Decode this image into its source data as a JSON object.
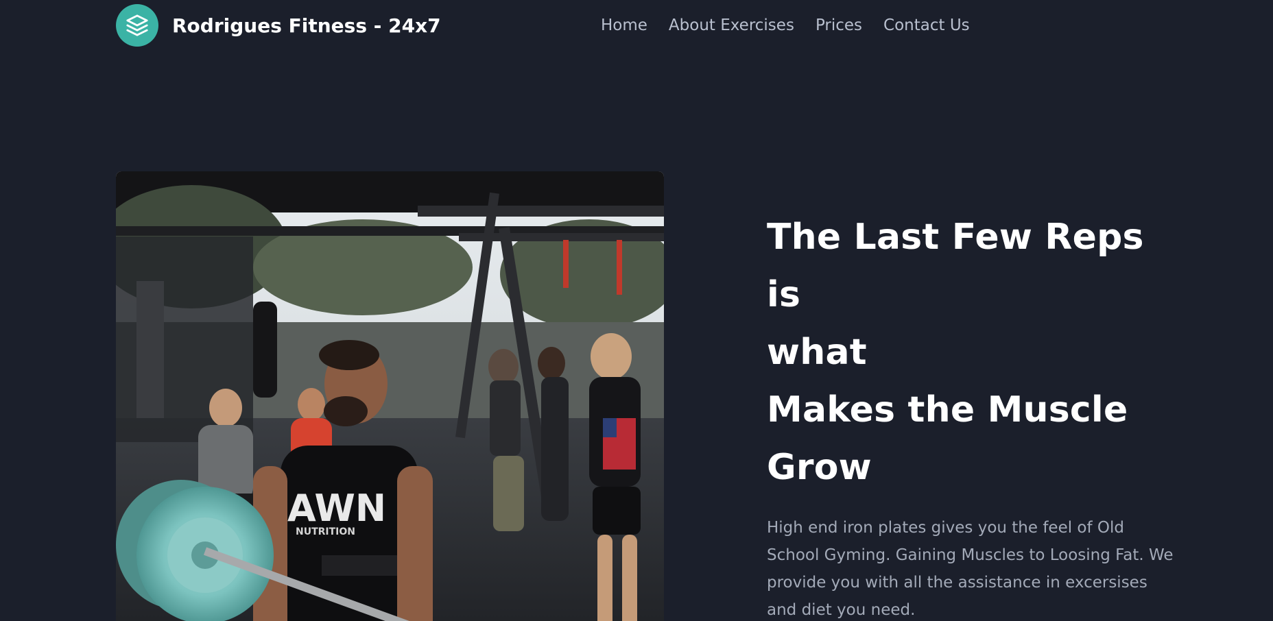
{
  "header": {
    "brand_name": "Rodrigues Fitness - 24x7",
    "logo_icon": "layers-icon",
    "nav": [
      {
        "label": "Home"
      },
      {
        "label": "About Exercises"
      },
      {
        "label": "Prices"
      },
      {
        "label": "Contact Us"
      }
    ]
  },
  "hero": {
    "title_lines": [
      "The Last Few Reps is",
      "what",
      "Makes the Muscle",
      "Grow"
    ],
    "description": "High end iron plates gives you the feel of Old School Gyming. Gaining Muscles to Loosing Fat. We provide you with all the assistance in excersises and diet you need.",
    "image": {
      "shirt_text": "AWN",
      "shirt_subtext": "NUTRITION"
    }
  },
  "colors": {
    "background": "#1b1f2b",
    "accent": "#3bb3a5",
    "nav_text": "#b9c0cf",
    "body_text": "#a3aab8"
  }
}
